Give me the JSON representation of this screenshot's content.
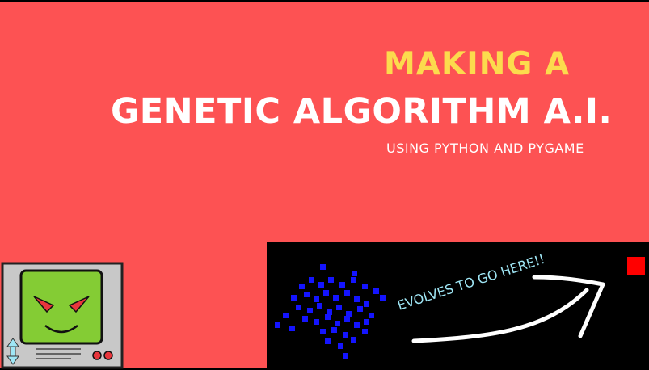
{
  "title": {
    "line1": "MAKING A",
    "line2": "GENETIC ALGORITHM A.I.",
    "subtitle": "USING PYTHON AND PYGAME"
  },
  "simulation": {
    "annotation": "EVOLVES TO GO HERE!!",
    "dot_color": "#1414ff",
    "goal_color": "#ff0000",
    "background": "#000000",
    "arrow_color": "#ffffff",
    "annotation_color": "#9fe6f5"
  },
  "colors": {
    "background": "#fd5253",
    "title_accent": "#fcdb4d",
    "title_main": "#ffffff",
    "robot_screen": "#84cc34",
    "robot_eyes": "#e8363c",
    "robot_body": "#c8c8c8"
  },
  "icons": [
    "robot-icon",
    "up-down-arrow-icon",
    "goal-square-icon",
    "curved-arrow-icon"
  ]
}
